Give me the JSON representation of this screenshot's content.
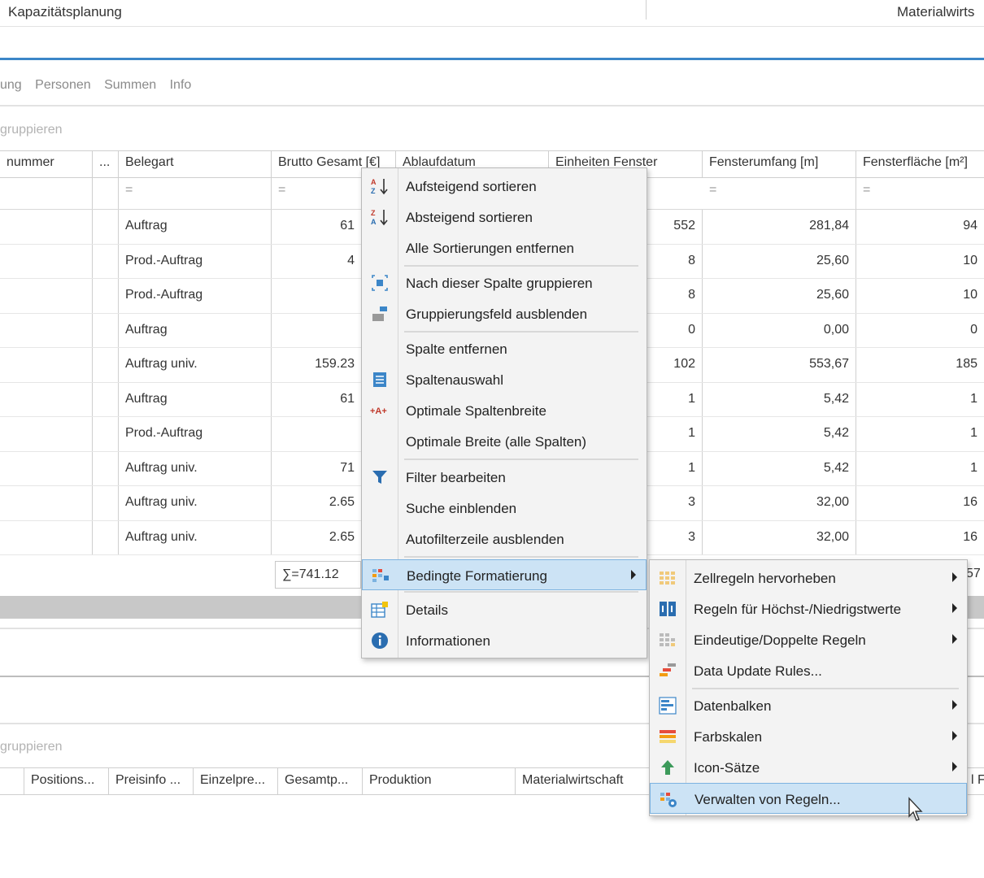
{
  "header": {
    "left_title": "Kapazitätsplanung",
    "right_title": "Materialwirts"
  },
  "tabs": [
    "ung",
    "Personen",
    "Summen",
    "Info"
  ],
  "group_hint_top": "gruppieren",
  "group_hint_bottom": "gruppieren",
  "columns": [
    "nummer",
    "...",
    "Belegart",
    "Brutto Gesamt [€]",
    "Ablaufdatum",
    "Einheiten Fenster",
    "Fensterumfang [m]",
    "Fensterfläche [m²]"
  ],
  "filter_symbol": "=",
  "rows": [
    {
      "belegart": "Auftrag",
      "brutto": "61",
      "einheiten": "552",
      "umfang": "281,84",
      "flaeche": "94"
    },
    {
      "belegart": "Prod.-Auftrag",
      "brutto": "4",
      "einheiten": "8",
      "umfang": "25,60",
      "flaeche": "10"
    },
    {
      "belegart": "Prod.-Auftrag",
      "brutto": "",
      "einheiten": "8",
      "umfang": "25,60",
      "flaeche": "10"
    },
    {
      "belegart": "Auftrag",
      "brutto": "",
      "einheiten": "0",
      "umfang": "0,00",
      "flaeche": "0"
    },
    {
      "belegart": "Auftrag univ.",
      "brutto": "159.23",
      "einheiten": "102",
      "umfang": "553,67",
      "flaeche": "185"
    },
    {
      "belegart": "Auftrag",
      "brutto": "61",
      "einheiten": "1",
      "umfang": "5,42",
      "flaeche": "1"
    },
    {
      "belegart": "Prod.-Auftrag",
      "brutto": "",
      "einheiten": "1",
      "umfang": "5,42",
      "flaeche": "1"
    },
    {
      "belegart": "Auftrag univ.",
      "brutto": "71",
      "einheiten": "1",
      "umfang": "5,42",
      "flaeche": "1"
    },
    {
      "belegart": "Auftrag univ.",
      "brutto": "2.65",
      "einheiten": "3",
      "umfang": "32,00",
      "flaeche": "16"
    },
    {
      "belegart": "Auftrag univ.",
      "brutto": "2.65",
      "einheiten": "3",
      "umfang": "32,00",
      "flaeche": "16"
    }
  ],
  "sum_value": "∑=741.12",
  "sum_right": "57",
  "bottom_columns": [
    "Positions...",
    "Preisinfo ...",
    "Einzelpre...",
    "Gesamtp...",
    "Produktion",
    "Materialwirtschaft",
    "l Fi"
  ],
  "context_menu": {
    "items": [
      {
        "label": "Aufsteigend sortieren",
        "icon": "sort-ascending-icon"
      },
      {
        "label": "Absteigend sortieren",
        "icon": "sort-descending-icon"
      },
      {
        "label": "Alle Sortierungen entfernen",
        "icon": ""
      },
      {
        "label": "Nach dieser Spalte gruppieren",
        "icon": "group-by-column-icon"
      },
      {
        "label": "Gruppierungsfeld ausblenden",
        "icon": "group-panel-icon"
      },
      {
        "label": "Spalte entfernen",
        "icon": ""
      },
      {
        "label": "Spaltenauswahl",
        "icon": "column-chooser-icon"
      },
      {
        "label": "Optimale Spaltenbreite",
        "icon": "best-fit-icon"
      },
      {
        "label": "Optimale Breite (alle Spalten)",
        "icon": ""
      },
      {
        "label": "Filter bearbeiten",
        "icon": "filter-icon"
      },
      {
        "label": "Suche einblenden",
        "icon": ""
      },
      {
        "label": "Autofilterzeile ausblenden",
        "icon": ""
      },
      {
        "label": "Bedingte Formatierung",
        "icon": "conditional-format-icon"
      },
      {
        "label": "Details",
        "icon": "details-icon"
      },
      {
        "label": "Informationen",
        "icon": "info-icon"
      }
    ]
  },
  "submenu": {
    "items": [
      {
        "label": "Zellregeln hervorheben",
        "icon": "highlight-cells-icon"
      },
      {
        "label": "Regeln für Höchst-/Niedrigstwerte",
        "icon": "top-bottom-rules-icon"
      },
      {
        "label": "Eindeutige/Doppelte Regeln",
        "icon": "unique-duplicate-icon"
      },
      {
        "label": "Data Update Rules...",
        "icon": "data-update-icon"
      },
      {
        "label": "Datenbalken",
        "icon": "data-bars-icon"
      },
      {
        "label": "Farbskalen",
        "icon": "color-scales-icon"
      },
      {
        "label": "Icon-Sätze",
        "icon": "icon-sets-icon"
      },
      {
        "label": "Verwalten von Regeln...",
        "icon": "manage-rules-icon"
      }
    ]
  },
  "colors": {
    "accent": "#3c86c8",
    "highlight": "#cce3f5",
    "highlight_border": "#7db3e0"
  }
}
